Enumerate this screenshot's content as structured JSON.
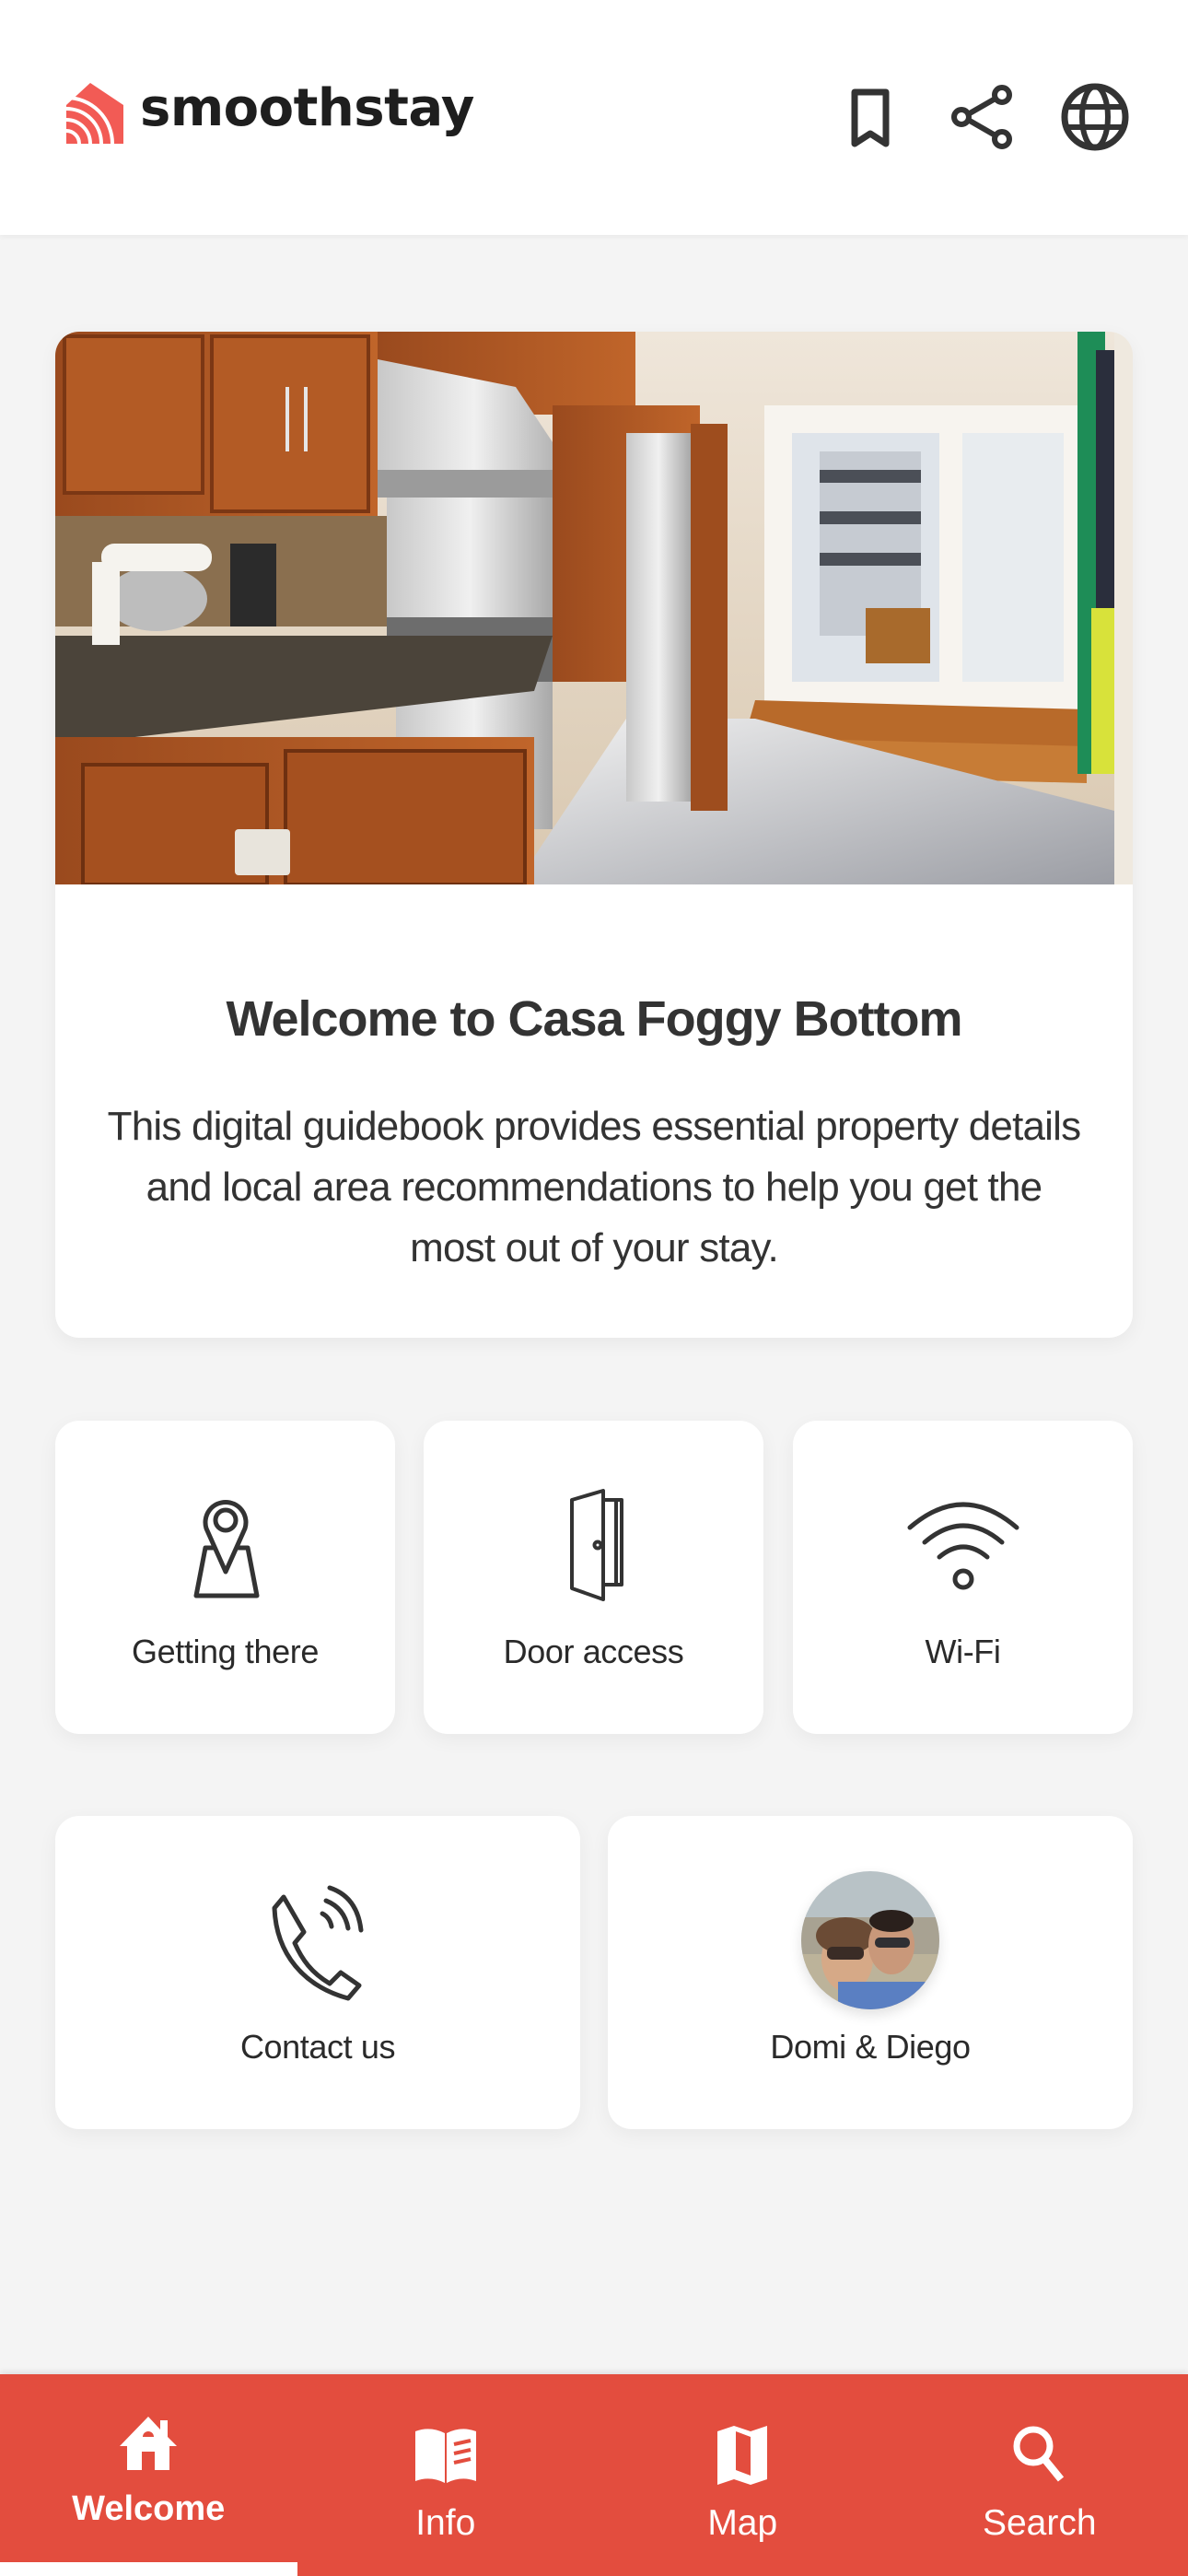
{
  "header": {
    "brand": "smoothstay",
    "brand_color": "#f25b55",
    "actions": [
      {
        "name": "bookmark",
        "icon": "bookmark-icon"
      },
      {
        "name": "share",
        "icon": "share-icon"
      },
      {
        "name": "language",
        "icon": "globe-icon"
      }
    ]
  },
  "hero": {
    "image_alt": "Kitchen with wooden cabinets, stainless steel appliances and doors to a balcony",
    "title": "Welcome to Casa Foggy Bottom",
    "description": "This digital guidebook provides essential property details and local area recommendations to help you get the most out of your stay."
  },
  "tiles": [
    {
      "label": "Getting there",
      "icon": "map-pin-icon"
    },
    {
      "label": "Door access",
      "icon": "door-icon"
    },
    {
      "label": "Wi-Fi",
      "icon": "wifi-icon"
    },
    {
      "label": "Contact us",
      "icon": "phone-icon"
    },
    {
      "label": "Domi & Diego",
      "icon": "host-avatar"
    }
  ],
  "bottom_nav": {
    "accent_color": "#e34d3e",
    "active_index": 0,
    "items": [
      {
        "label": "Welcome",
        "icon": "home-icon"
      },
      {
        "label": "Info",
        "icon": "book-icon"
      },
      {
        "label": "Map",
        "icon": "map-icon"
      },
      {
        "label": "Search",
        "icon": "search-icon"
      }
    ]
  }
}
